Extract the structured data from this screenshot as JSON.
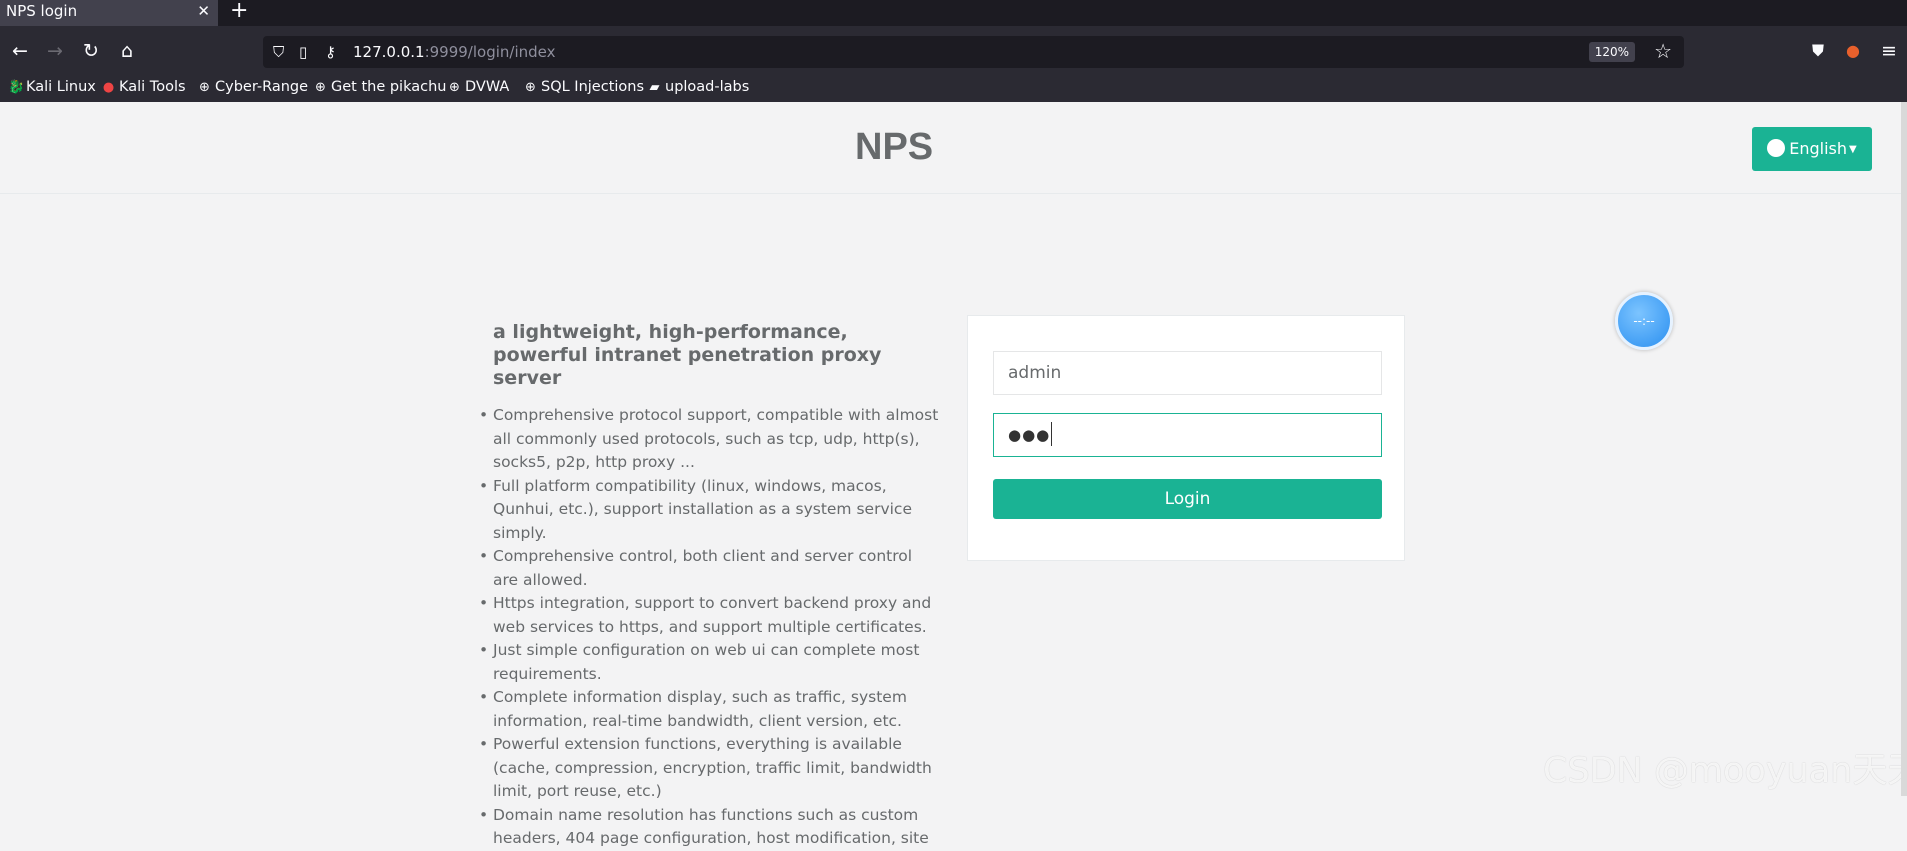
{
  "browser": {
    "tab_title": "NPS login",
    "tab_close": "✕",
    "new_tab": "+",
    "url_host": "127.0.0.1",
    "url_rest": ":9999/login/index",
    "zoom": "120%",
    "bookmarks": [
      "Kali Linux",
      "Kali Tools",
      "Cyber-Range",
      "Get the pikachu",
      "DVWA",
      "SQL Injections",
      "upload-labs"
    ]
  },
  "header": {
    "brand": "NPS",
    "language": "English"
  },
  "info": {
    "title": "a lightweight, high-performance, powerful intranet penetration proxy server",
    "features": [
      "Comprehensive protocol support, compatible with almost all commonly used protocols, such as tcp, udp, http(s), socks5, p2p, http proxy ...",
      "Full platform compatibility (linux, windows, macos, Qunhui, etc.), support installation as a system service simply.",
      "Comprehensive control, both client and server control are allowed.",
      "Https integration, support to convert backend proxy and web services to https, and support multiple certificates.",
      "Just simple configuration on web ui can complete most requirements.",
      "Complete information display, such as traffic, system information, real-time bandwidth, client version, etc.",
      "Powerful extension functions, everything is available (cache, compression, encryption, traffic limit, bandwidth limit, port reuse, etc.)",
      "Domain name resolution has functions such as custom headers, 404 page configuration, host modification, site"
    ]
  },
  "login": {
    "username": "admin",
    "password_mask": "●●●",
    "button": "Login"
  },
  "widget": {
    "clock_text": "--:--"
  },
  "watermark": "CSDN @mooyuan天天",
  "colors": {
    "accent": "#1ab394",
    "text": "#676a6c",
    "chrome_dark": "#1c1b22",
    "chrome": "#2b2a33"
  }
}
